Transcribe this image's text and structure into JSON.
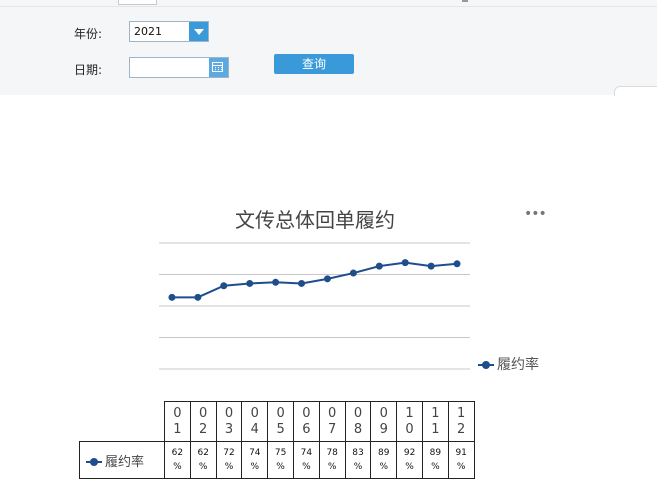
{
  "filters": {
    "year_label": "年份:",
    "year_value": "2021",
    "date_label": "日期:",
    "date_value": "",
    "query_button": "查询"
  },
  "toolbar": {
    "more_icon": "•••"
  },
  "chart_data": {
    "type": "line",
    "title": "文传总体回单履约",
    "categories": [
      "01",
      "02",
      "03",
      "04",
      "05",
      "06",
      "07",
      "08",
      "09",
      "10",
      "11",
      "12"
    ],
    "series": [
      {
        "name": "履约率",
        "values": [
          62,
          62,
          72,
          74,
          75,
          74,
          78,
          83,
          89,
          92,
          89,
          91
        ],
        "labels": [
          "62%",
          "62%",
          "72%",
          "74%",
          "75%",
          "74%",
          "78%",
          "83%",
          "89%",
          "92%",
          "89%",
          "91%"
        ]
      }
    ],
    "ylim": [
      0,
      100
    ],
    "grid": true,
    "legend_position": "right",
    "color": "#1f4e8c"
  }
}
